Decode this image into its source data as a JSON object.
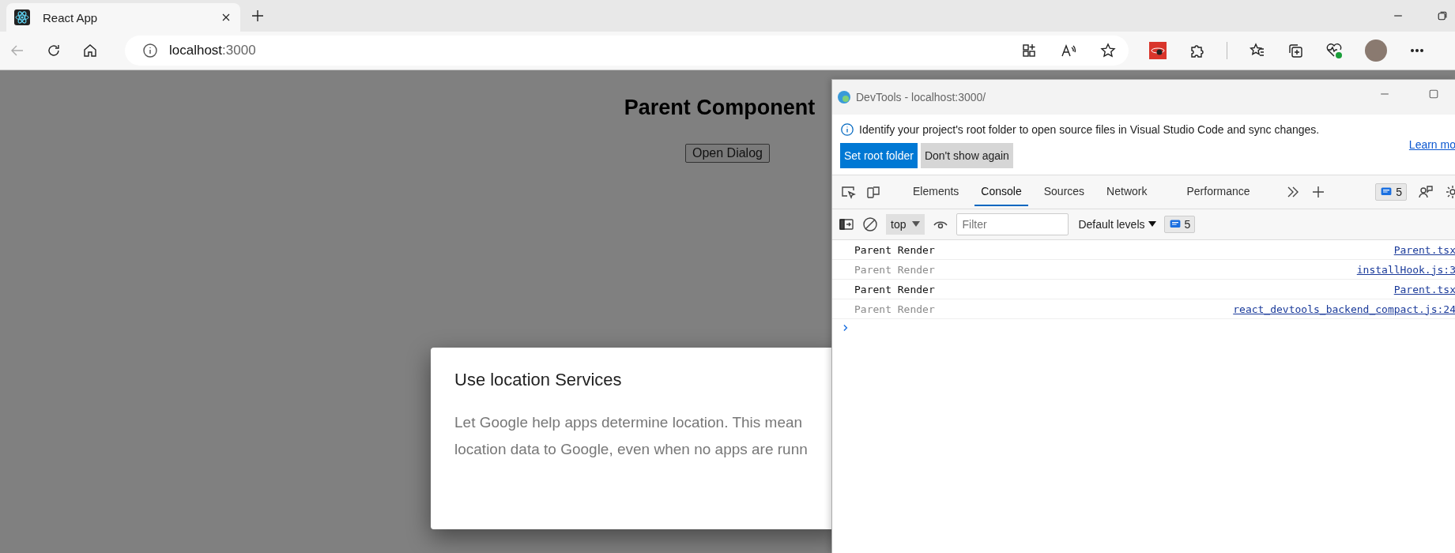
{
  "browser": {
    "tab": {
      "title": "React App"
    },
    "address": {
      "host": "localhost",
      "port": ":3000"
    }
  },
  "page": {
    "heading": "Parent Component",
    "button": "Open Dialog"
  },
  "dialog": {
    "title": "Use location Services",
    "lines": [
      "Let Google help apps determine location. This mean",
      "location data to Google, even when no apps are runn"
    ]
  },
  "devtools": {
    "title": "DevTools - localhost:3000/",
    "infobar": {
      "message": "Identify your project's root folder to open source files in Visual Studio Code and sync changes.",
      "primary_button": "Set root folder",
      "secondary_button": "Don't show again",
      "link": "Learn mo"
    },
    "tabs": [
      {
        "label": "Elements",
        "selected": false
      },
      {
        "label": "Console",
        "selected": true
      },
      {
        "label": "Sources",
        "selected": false
      },
      {
        "label": "Network",
        "selected": false
      },
      {
        "label": "Performance",
        "selected": false
      }
    ],
    "issues_count": "5",
    "context": "top",
    "filter_placeholder": "Filter",
    "levels": "Default levels",
    "message_count": "5",
    "messages": [
      {
        "text": "Parent Render",
        "source": "Parent.tsx",
        "dimmed": false
      },
      {
        "text": "Parent Render",
        "source": "installHook.js:3",
        "dimmed": true
      },
      {
        "text": "Parent Render",
        "source": "Parent.tsx",
        "dimmed": false
      },
      {
        "text": "Parent Render",
        "source": "react_devtools_backend_compact.js:24",
        "dimmed": true
      }
    ]
  }
}
